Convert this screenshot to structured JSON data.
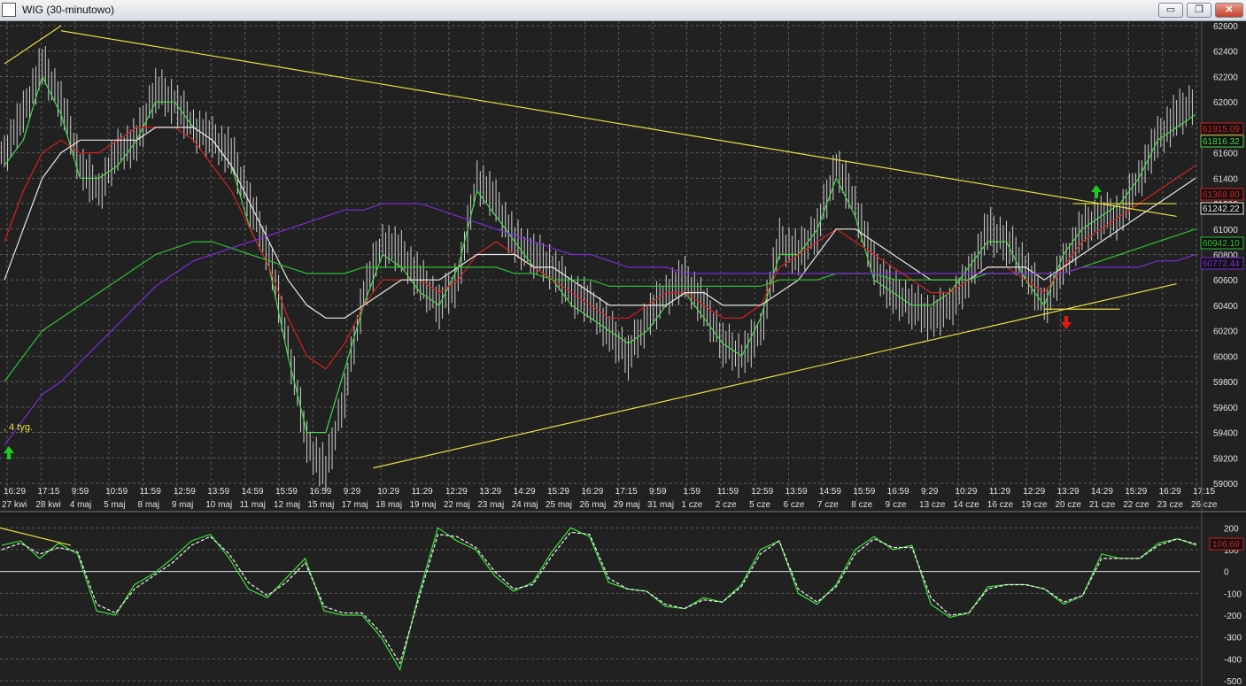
{
  "window": {
    "title": "WIG (30-minutowo)",
    "minimize_label": "▭",
    "restore_label": "❐",
    "close_label": "✕"
  },
  "colors": {
    "background": "#212121",
    "grid": "#5a5a5a",
    "price": "#d0d0d0",
    "ma_short": "#4cd64c",
    "ma_mid": "#d62020",
    "ma_white": "#e8e8e8",
    "ma_long_green": "#2fbf2f",
    "ma_purple": "#7b2bd6",
    "trendline": "#e8e040",
    "signal_up": "#1ccc1c",
    "signal_down": "#e01818"
  },
  "chart_data": [
    {
      "type": "line",
      "ylim": [
        59000,
        62600
      ],
      "y_ticks": [
        59000,
        59200,
        59400,
        59600,
        59800,
        60000,
        60200,
        60400,
        60600,
        60800,
        61000,
        61200,
        61400,
        61600,
        61800,
        62000,
        62200,
        62400,
        62600
      ],
      "time_ticks": [
        "16:29",
        "17:15",
        "9:59",
        "10:59",
        "11:59",
        "12:59",
        "13:59",
        "14:59",
        "15:59",
        "16:59",
        "9:29",
        "10:29",
        "11:29",
        "12:29",
        "13:29",
        "14:29",
        "15:29",
        "16:29",
        "17:15",
        "9:59",
        "1:59",
        "11:59",
        "12:59",
        "13:59",
        "14:59",
        "15:59",
        "16:59",
        "9:29",
        "10:29",
        "11:29",
        "12:29",
        "13:29",
        "14:29",
        "15:29",
        "16:29",
        "17:15"
      ],
      "date_ticks": [
        "27 kwi",
        "28 kwi",
        "4 maj",
        "5 maj",
        "8 maj",
        "9 maj",
        "10 maj",
        "11 maj",
        "12 maj",
        "15 maj",
        "17 maj",
        "18 maj",
        "19 maj",
        "22 maj",
        "23 maj",
        "24 maj",
        "25 maj",
        "26 maj",
        "29 maj",
        "31 maj",
        "1 cze",
        "2 cze",
        "5 cze",
        "6 cze",
        "7 cze",
        "8 cze",
        "9 cze",
        "13 cze",
        "14 cze",
        "16 cze",
        "19 cze",
        "20 cze",
        "21 cze",
        "22 cze",
        "23 cze",
        "26 cze"
      ],
      "price_close": [
        61600,
        61900,
        62300,
        62000,
        61500,
        61300,
        61600,
        61700,
        62100,
        62000,
        61800,
        61700,
        61600,
        61200,
        60800,
        60100,
        59300,
        59100,
        59700,
        60500,
        60900,
        60800,
        60600,
        60400,
        60600,
        61400,
        61200,
        60900,
        60800,
        60700,
        60500,
        60400,
        60200,
        60000,
        60300,
        60500,
        60600,
        60400,
        60100,
        60000,
        60200,
        60900,
        60800,
        61000,
        61500,
        61200,
        60700,
        60500,
        60400,
        60300,
        60400,
        60600,
        61000,
        60900,
        60700,
        60400,
        60700,
        61000,
        61100,
        61100,
        61400,
        61700,
        61900,
        62000
      ],
      "price_range": [
        59000,
        62600
      ],
      "series": [
        {
          "key": "ma_short",
          "values": [
            61500,
            61700,
            62200,
            61900,
            61400,
            61400,
            61500,
            61700,
            62000,
            62000,
            61800,
            61700,
            61500,
            61000,
            60700,
            60000,
            59400,
            59400,
            59900,
            60400,
            60800,
            60700,
            60500,
            60400,
            60700,
            61300,
            61100,
            60900,
            60700,
            60600,
            60400,
            60300,
            60200,
            60100,
            60200,
            60400,
            60500,
            60300,
            60100,
            60000,
            60300,
            60800,
            60800,
            61000,
            61400,
            61100,
            60600,
            60500,
            60400,
            60400,
            60500,
            60700,
            60900,
            60900,
            60600,
            60400,
            60800,
            61000,
            61100,
            61200,
            61400,
            61700,
            61800,
            61900
          ]
        },
        {
          "key": "ma_mid",
          "values": [
            60900,
            61300,
            61600,
            61700,
            61600,
            61600,
            61700,
            61800,
            61800,
            61800,
            61700,
            61500,
            61300,
            61000,
            60700,
            60300,
            60000,
            59900,
            60100,
            60400,
            60600,
            60600,
            60600,
            60500,
            60600,
            60800,
            60900,
            60800,
            60700,
            60600,
            60500,
            60400,
            60300,
            60300,
            60400,
            60500,
            60500,
            60400,
            60300,
            60300,
            60400,
            60700,
            60800,
            60900,
            61000,
            60900,
            60800,
            60700,
            60600,
            60500,
            60500,
            60600,
            60700,
            60700,
            60600,
            60500,
            60700,
            60900,
            61000,
            61100,
            61200,
            61300,
            61400,
            61500
          ]
        },
        {
          "key": "ma_white",
          "values": [
            60600,
            61000,
            61400,
            61600,
            61700,
            61700,
            61700,
            61700,
            61800,
            61800,
            61800,
            61700,
            61500,
            61200,
            60900,
            60600,
            60400,
            60300,
            60300,
            60400,
            60500,
            60600,
            60600,
            60600,
            60700,
            60800,
            60800,
            60800,
            60700,
            60700,
            60600,
            60500,
            60400,
            60400,
            60400,
            60400,
            60500,
            60500,
            60400,
            60400,
            60400,
            60500,
            60600,
            60800,
            61000,
            61000,
            60900,
            60800,
            60700,
            60600,
            60600,
            60600,
            60700,
            60700,
            60700,
            60600,
            60700,
            60800,
            60900,
            61000,
            61100,
            61200,
            61300,
            61400
          ]
        },
        {
          "key": "ma_long_green",
          "values": [
            59800,
            60000,
            60200,
            60300,
            60400,
            60500,
            60600,
            60700,
            60800,
            60850,
            60900,
            60900,
            60850,
            60800,
            60750,
            60700,
            60650,
            60650,
            60650,
            60700,
            60700,
            60700,
            60700,
            60700,
            60700,
            60700,
            60700,
            60650,
            60650,
            60600,
            60600,
            60600,
            60550,
            60550,
            60550,
            60550,
            60550,
            60550,
            60550,
            60550,
            60550,
            60600,
            60600,
            60600,
            60650,
            60650,
            60650,
            60600,
            60600,
            60600,
            60600,
            60600,
            60650,
            60650,
            60650,
            60650,
            60650,
            60700,
            60750,
            60800,
            60850,
            60900,
            60950,
            61000
          ]
        },
        {
          "key": "ma_purple",
          "values": [
            59300,
            59500,
            59700,
            59800,
            59950,
            60100,
            60250,
            60400,
            60550,
            60650,
            60750,
            60800,
            60850,
            60900,
            60950,
            61000,
            61050,
            61100,
            61150,
            61150,
            61200,
            61200,
            61200,
            61150,
            61100,
            61050,
            61000,
            60950,
            60900,
            60850,
            60800,
            60800,
            60750,
            60700,
            60700,
            60700,
            60650,
            60650,
            60650,
            60650,
            60650,
            60650,
            60650,
            60650,
            60650,
            60650,
            60650,
            60650,
            60650,
            60650,
            60650,
            60650,
            60650,
            60650,
            60650,
            60650,
            60650,
            60700,
            60700,
            60700,
            60700,
            60750,
            60750,
            60800
          ]
        }
      ],
      "price_labels": [
        {
          "value": "61915.09",
          "color": "#d62020"
        },
        {
          "value": "61816.32",
          "color": "#4cd64c"
        },
        {
          "value": "61368.80",
          "color": "#d62020"
        },
        {
          "value": "61242.22",
          "color": "#e8e8e8"
        },
        {
          "value": "60942.10",
          "color": "#2fbf2f"
        },
        {
          "value": "60772.44",
          "color": "#7b2bd6"
        }
      ],
      "annotation": ", 4 tyg."
    },
    {
      "type": "line",
      "ylim": [
        -500,
        250
      ],
      "y_ticks": [
        -500,
        -400,
        -300,
        -200,
        -100,
        0,
        100,
        200
      ],
      "series": [
        {
          "key": "osc_green",
          "values": [
            120,
            140,
            60,
            130,
            80,
            -180,
            -200,
            -60,
            -10,
            60,
            140,
            170,
            60,
            -80,
            -120,
            -30,
            60,
            -180,
            -200,
            -200,
            -300,
            -450,
            -100,
            200,
            140,
            100,
            -20,
            -90,
            -50,
            90,
            200,
            160,
            -50,
            -80,
            -90,
            -160,
            -170,
            -120,
            -140,
            -60,
            100,
            140,
            -100,
            -150,
            -60,
            100,
            160,
            100,
            120,
            -150,
            -210,
            -190,
            -70,
            -60,
            -60,
            -80,
            -150,
            -110,
            80,
            60,
            60,
            130,
            150,
            120
          ]
        },
        {
          "key": "osc_white",
          "values": [
            100,
            130,
            80,
            110,
            90,
            -150,
            -190,
            -80,
            -20,
            40,
            120,
            160,
            80,
            -50,
            -110,
            -50,
            40,
            -160,
            -190,
            -190,
            -280,
            -420,
            -120,
            170,
            160,
            110,
            0,
            -80,
            -60,
            70,
            180,
            170,
            -30,
            -80,
            -90,
            -150,
            -170,
            -130,
            -140,
            -70,
            80,
            140,
            -80,
            -140,
            -70,
            80,
            150,
            110,
            110,
            -120,
            -200,
            -190,
            -80,
            -60,
            -60,
            -80,
            -140,
            -110,
            60,
            60,
            60,
            120,
            150,
            125
          ]
        }
      ],
      "value_label": "106.69",
      "value_color": "#d62020"
    }
  ]
}
